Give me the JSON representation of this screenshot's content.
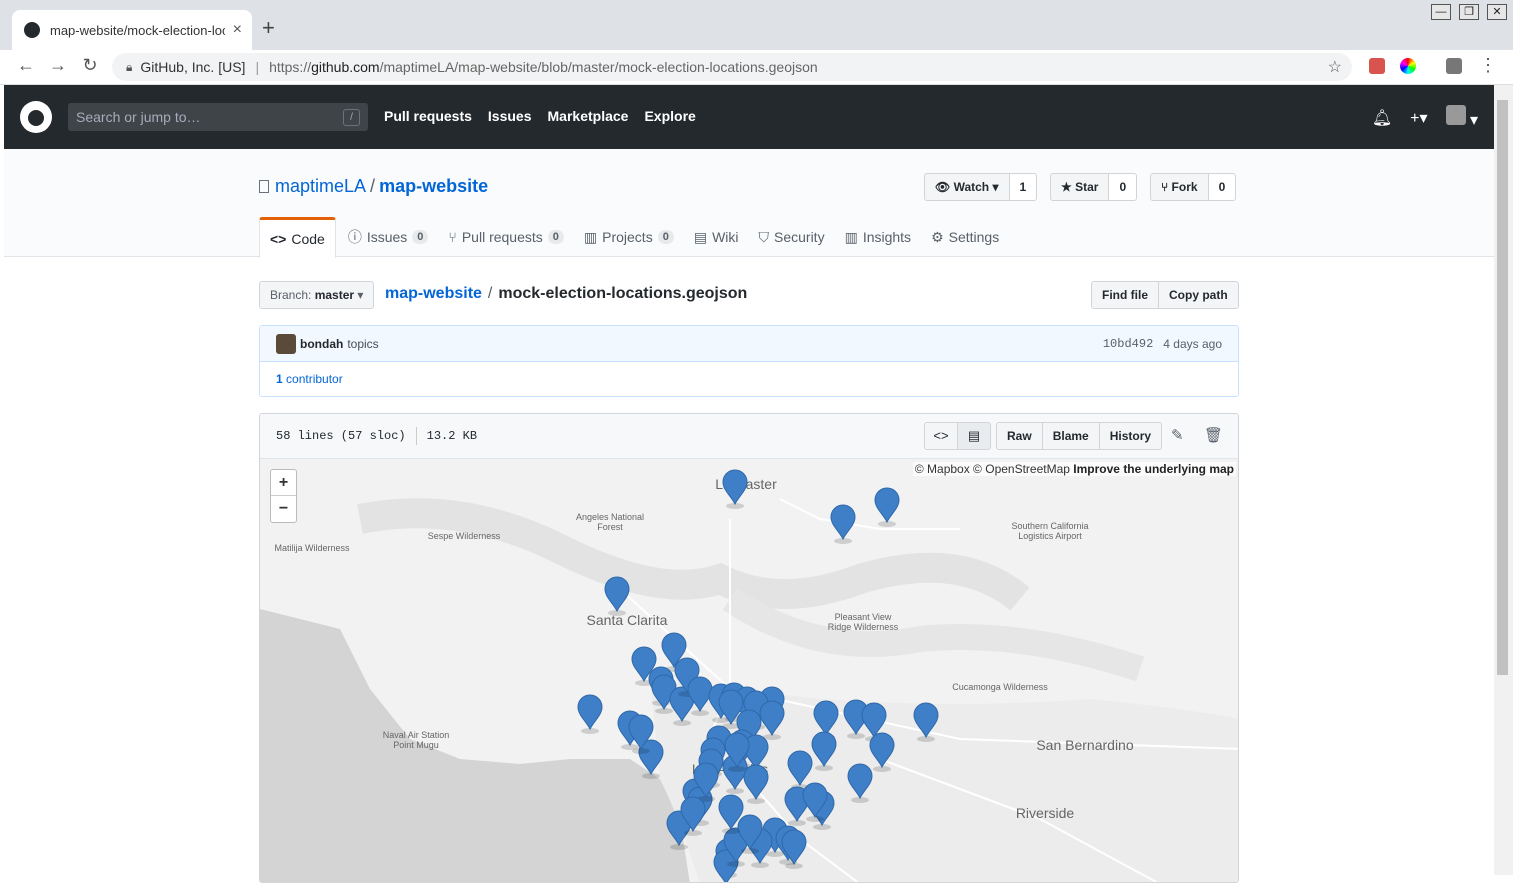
{
  "browser": {
    "tab_title": "map-website/mock-election-locations.geojson",
    "tab_close": "×",
    "new_tab": "+",
    "window_buttons": [
      "—",
      "❐",
      "✕"
    ],
    "omnibox": {
      "cert_label": "GitHub, Inc. [US]",
      "url_scheme": "https://",
      "url_host": "github.com",
      "url_path": "/maptimeLA/map-website/blob/master/mock-election-locations.geojson"
    }
  },
  "github_header": {
    "search_placeholder": "Search or jump to…",
    "search_shortcut": "/",
    "nav": [
      "Pull requests",
      "Issues",
      "Marketplace",
      "Explore"
    ]
  },
  "repo": {
    "owner": "maptimeLA",
    "separator": "/",
    "name": "map-website",
    "watch": {
      "label": "Watch",
      "count": "1"
    },
    "star": {
      "label": "Star",
      "count": "0"
    },
    "fork": {
      "label": "Fork",
      "count": "0"
    },
    "tabs": [
      {
        "icon": "<>",
        "label": "Code",
        "count": ""
      },
      {
        "icon": "ⓘ",
        "label": "Issues",
        "count": "0"
      },
      {
        "icon": "⑂",
        "label": "Pull requests",
        "count": "0"
      },
      {
        "icon": "▥",
        "label": "Projects",
        "count": "0"
      },
      {
        "icon": "▤",
        "label": "Wiki",
        "count": ""
      },
      {
        "icon": "⛉",
        "label": "Security",
        "count": ""
      },
      {
        "icon": "▥",
        "label": "Insights",
        "count": ""
      },
      {
        "icon": "⚙",
        "label": "Settings",
        "count": ""
      }
    ]
  },
  "file_nav": {
    "branch_label": "Branch:",
    "branch_name": "master",
    "crumb_repo": "map-website",
    "crumb_sep": "/",
    "crumb_file": "mock-election-locations.geojson",
    "find_file": "Find file",
    "copy_path": "Copy path"
  },
  "commit": {
    "author": "bondah",
    "message": "topics",
    "sha": "10bd492",
    "time": "4 days ago",
    "contributors_count": "1",
    "contributors_label": "contributor"
  },
  "file": {
    "lines": "58 lines (57 sloc)",
    "size": "13.2 KB",
    "raw": "Raw",
    "blame": "Blame",
    "history": "History"
  },
  "map": {
    "attribution_prefix": "© Mapbox © OpenStreetMap",
    "attribution_link": "Improve the underlying map",
    "zoom_in": "+",
    "zoom_out": "−",
    "pin_color": "#3f7fc8",
    "places": [
      {
        "name": "Lancaster",
        "size": "large"
      },
      {
        "name": "Angeles National",
        "size": "small"
      },
      {
        "name": "Forest",
        "size": "small"
      },
      {
        "name": "Sespe Wilderness",
        "size": "small"
      },
      {
        "name": "Matilija Wilderness",
        "size": "small"
      },
      {
        "name": "Southern California",
        "size": "small"
      },
      {
        "name": "Logistics Airport",
        "size": "small"
      },
      {
        "name": "Santa Clarita",
        "size": "large"
      },
      {
        "name": "Pleasant View",
        "size": "small"
      },
      {
        "name": "Ridge Wilderness",
        "size": "small"
      },
      {
        "name": "Cucamonga Wilderness",
        "size": "small"
      },
      {
        "name": "Naval Air Station",
        "size": "small"
      },
      {
        "name": "Point Mugu",
        "size": "small"
      },
      {
        "name": "San Bernardino",
        "size": "large"
      },
      {
        "name": "Los Angeles",
        "size": "large"
      },
      {
        "name": "Riverside",
        "size": "large"
      }
    ],
    "marker_count": 56
  }
}
